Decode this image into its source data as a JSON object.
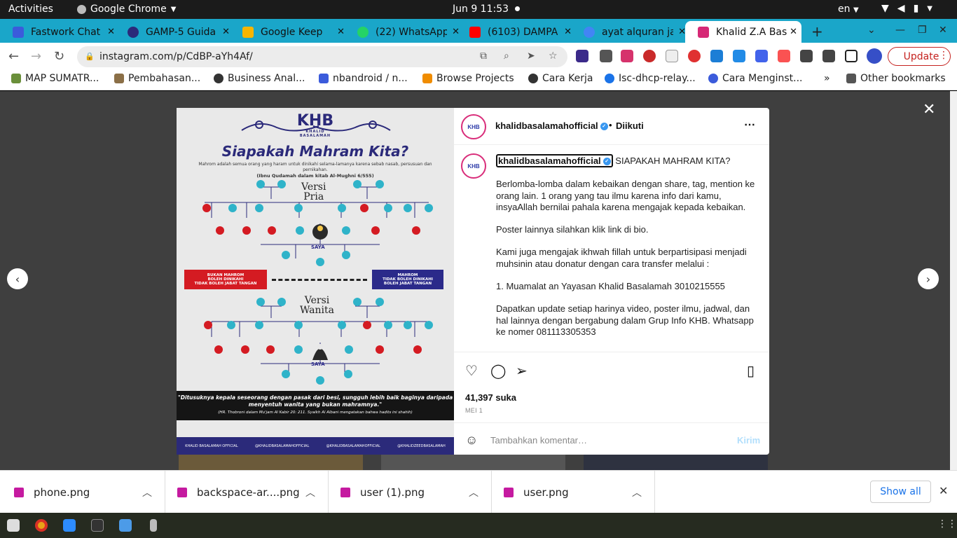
{
  "system_bar": {
    "activities": "Activities",
    "app_name": "Google Chrome",
    "clock": "Jun 9  11:53",
    "lang": "en"
  },
  "tabs": [
    {
      "title": "Fastwork Chat",
      "color": "#3b5bdb"
    },
    {
      "title": "GAMP-5 Guida",
      "color": "#2b2a7a"
    },
    {
      "title": "Google Keep",
      "color": "#f7b500"
    },
    {
      "title": "(22) WhatsApp",
      "color": "#25d366"
    },
    {
      "title": "(6103) DAMPA",
      "color": "#ff0000"
    },
    {
      "title": "ayat alquran ja",
      "color": "#4285f4"
    },
    {
      "title": "Khalid Z.A Bas",
      "color": "#d62976"
    }
  ],
  "address": {
    "url": "instagram.com/p/CdBP-aYh4Af/"
  },
  "update_label": "Update",
  "bookmarks": [
    {
      "label": "MAP SUMATR...",
      "color": "#6a8f3a"
    },
    {
      "label": "Pembahasan...",
      "color": "#8b6f47"
    },
    {
      "label": "Business Anal...",
      "color": "#333333"
    },
    {
      "label": "nbandroid / n...",
      "color": "#3b5bdb"
    },
    {
      "label": "Browse Projects",
      "color": "#f08c00"
    },
    {
      "label": "Cara Kerja",
      "color": "#333333"
    },
    {
      "label": "Isc-dhcp-relay...",
      "color": "#1a73e8"
    },
    {
      "label": "Cara Menginst...",
      "color": "#3b5bdb"
    }
  ],
  "bookmarks_more": "»",
  "other_bookmarks": "Other bookmarks",
  "post": {
    "username": "khalidbasalamahofficial",
    "follow_state": "Diikuti",
    "caption_lead": "SIAPAKAH MAHRAM KITA?",
    "paragraphs": [
      "Berlomba-lomba dalam kebaikan dengan share, tag, mention ke orang lain. 1 orang yang tau ilmu karena info dari kamu, insyaAllah bernilai pahala karena mengajak kepada kebaikan.",
      "Poster lainnya silahkan klik link di bio.",
      "Kami juga mengajak ikhwah fillah untuk berpartisipasi menjadi muhsinin atau donatur dengan cara transfer melalui :",
      "1. Muamalat an Yayasan Khalid Basalamah 3010215555",
      "Dapatkan update setiap harinya video, poster ilmu, jadwal, dan hal lainnya dengan bergabung dalam Grup Info KHB. Whatsapp ke nomer 081113305353"
    ],
    "likes": "41,397 suka",
    "date": "MEI 1",
    "comment_placeholder": "Tambahkan komentar…",
    "send_label": "Kirim",
    "avatar_text": "KHB"
  },
  "poster": {
    "logo": "KHB",
    "logo_sub": "KHALID BASALAMAH",
    "title": "Siapakah Mahram Kita?",
    "subtitle": "Mahrom adalah semua orang yang haram untuk dinikahi selama-lamanya karena sebab nasab, persusuan dan pernikahan.",
    "source": "(Ibnu Qudamah dalam kitab Al-Mughni 6/555)",
    "versi_pria": "Versi\nPria",
    "versi_wanita": "Versi\nWanita",
    "legend_red": "BUKAN MAHROM\nBOLEH DINIKAHI\nTIDAK BOLEH JABAT TANGAN",
    "legend_blue": "MAHROM\nTIDAK BOLEH DINIKAHI\nBOLEH JABAT TANGAN",
    "quote": "\"Ditusuknya kepala seseorang dengan pasak dari besi, sungguh lebih baik baginya daripada menyentuh wanita yang bukan mahramnya.\"",
    "quote_src": "(HR. Thobroni dalam Mu'jam Al Kabir 20: 211. Syaikh Al Albani mengatakan bahwa hadits ini shahih)",
    "footer": [
      "KHALID BASALAMAH OFFICIAL",
      "@KHALIDBASALAMAHOFFICIAL",
      "@KHALIDBASALAMAHOFFICIAL",
      "@KHALIDZEEDBASALAMAH"
    ],
    "saya": "SAYA"
  },
  "downloads": [
    {
      "name": "phone.png"
    },
    {
      "name": "backspace-ar....png"
    },
    {
      "name": "user (1).png"
    },
    {
      "name": "user.png"
    }
  ],
  "show_all": "Show all"
}
